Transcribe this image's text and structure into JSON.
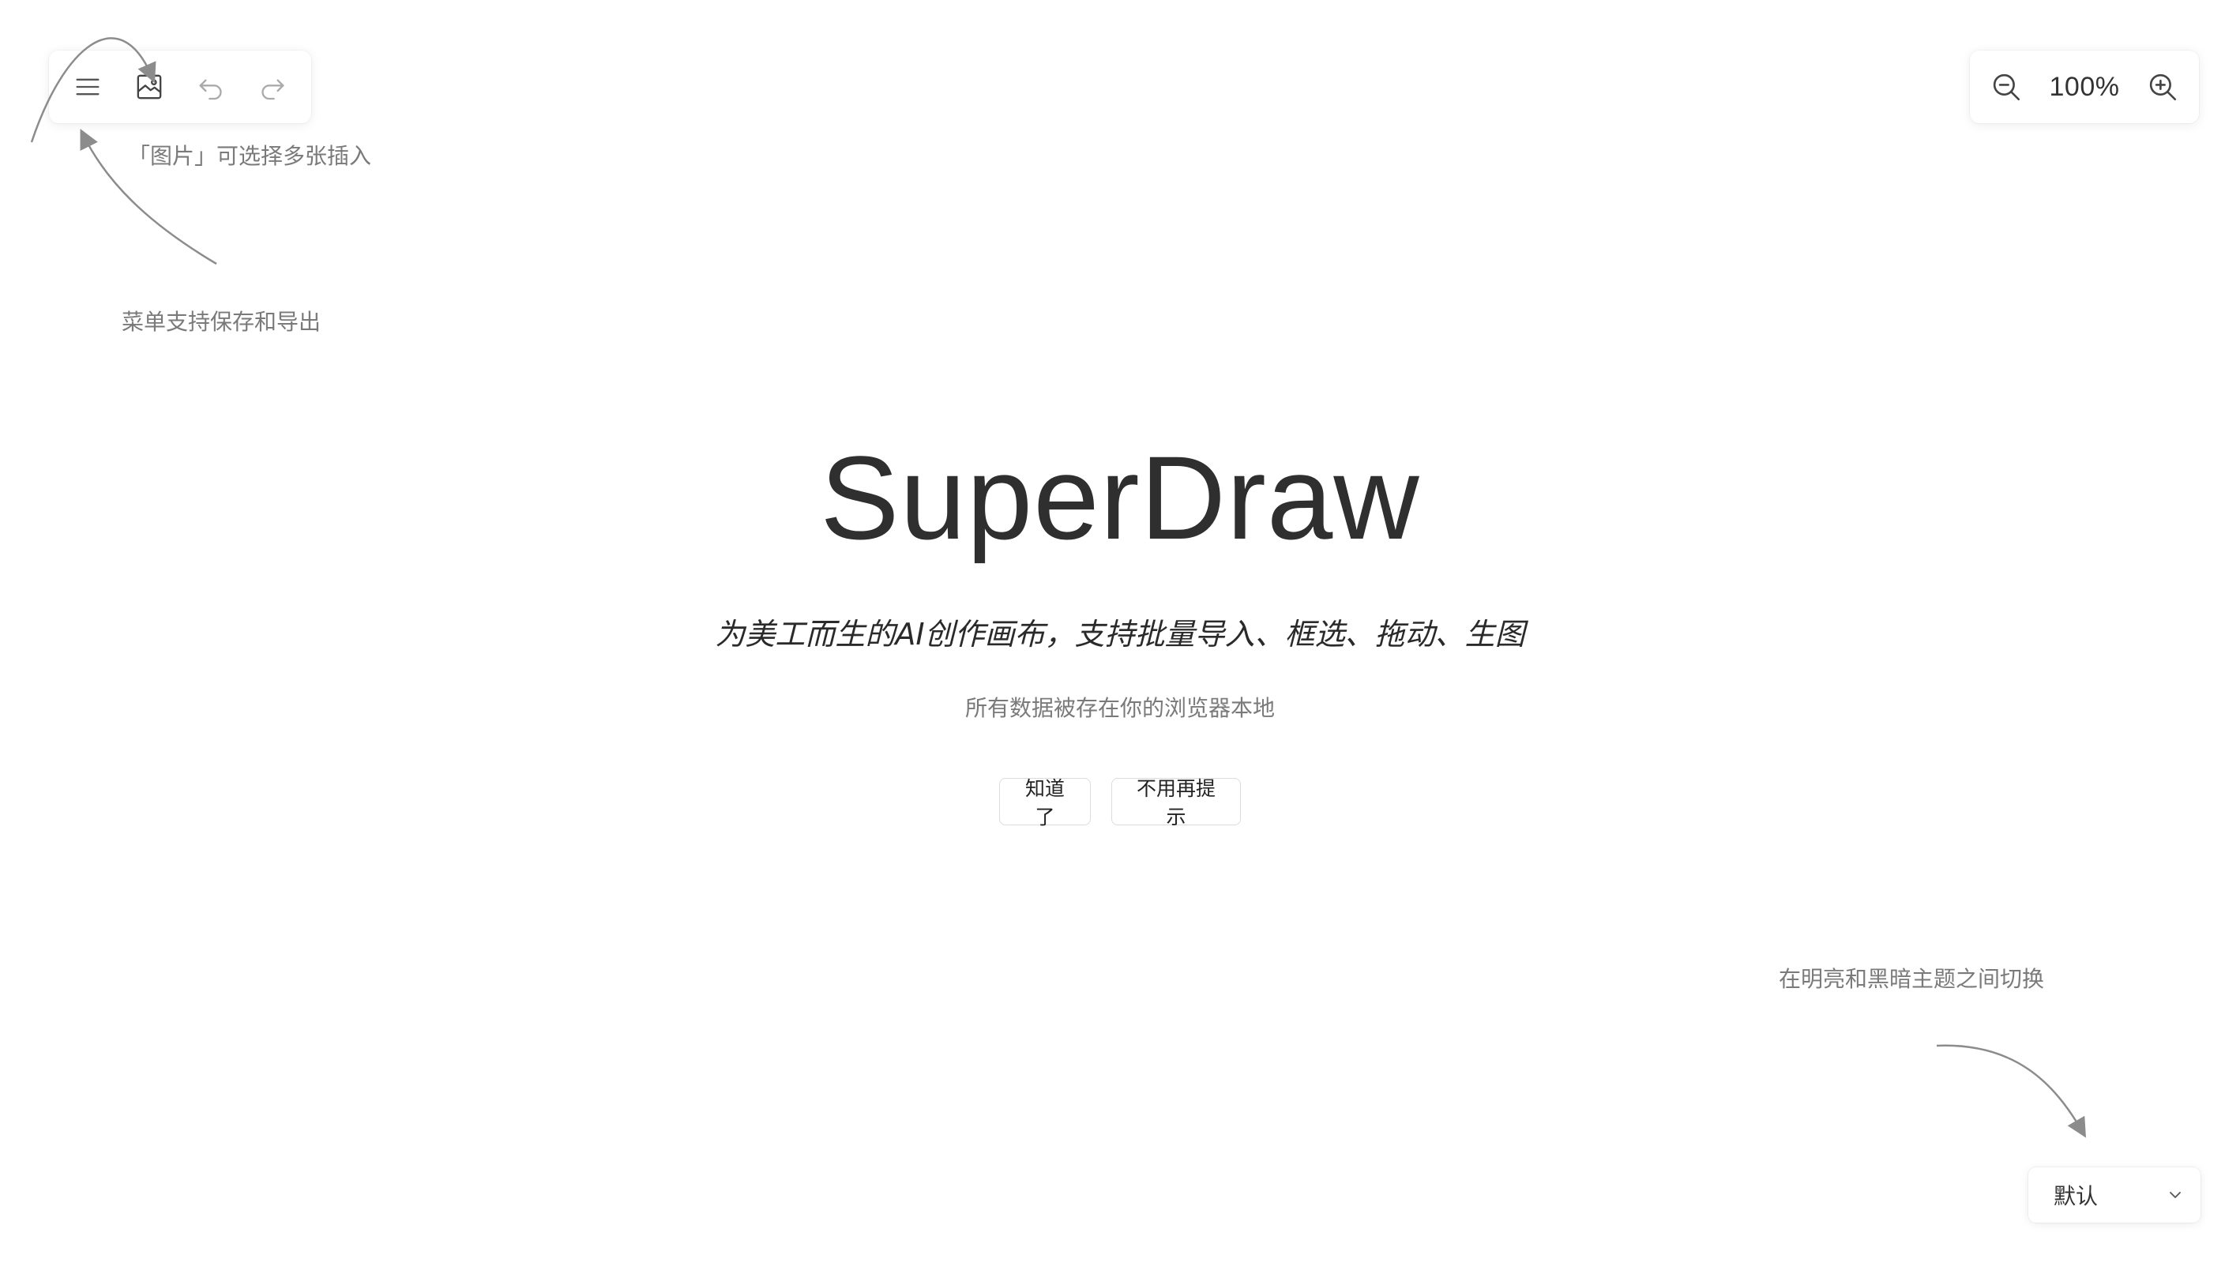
{
  "toolbar": {
    "icons": [
      "menu-icon",
      "image-icon",
      "undo-icon",
      "redo-icon"
    ]
  },
  "zoom": {
    "level": "100%",
    "icons": [
      "zoom-out-icon",
      "zoom-in-icon"
    ]
  },
  "hints": {
    "image": "「图片」可选择多张插入",
    "menu": "菜单支持保存和导出",
    "theme": "在明亮和黑暗主题之间切换"
  },
  "welcome": {
    "title": "SuperDraw",
    "subtitle": "为美工而生的AI创作画布，支持批量导入、框选、拖动、生图",
    "note": "所有数据被存在你的浏览器本地",
    "ok_label": "知道了",
    "never_label": "不用再提示"
  },
  "theme_select": {
    "value": "默认",
    "icon": "chevron-down-icon"
  },
  "colors": {
    "background": "#ffffff",
    "text": "#333333",
    "hint": "#7a7a7a",
    "arrow": "#8c8c8c"
  }
}
